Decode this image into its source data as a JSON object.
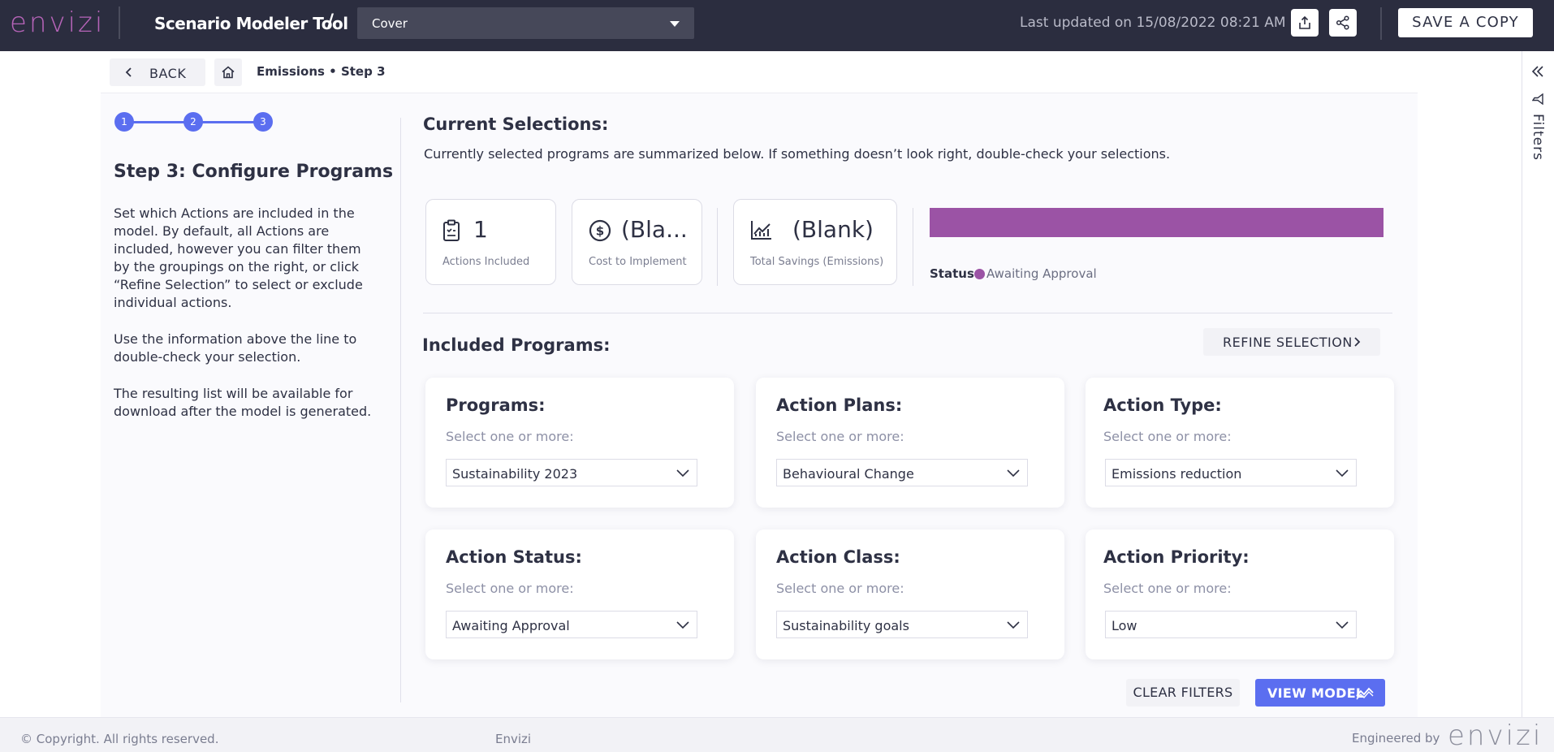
{
  "app": {
    "logo": "envizi",
    "title": "Scenario Modeler Tool",
    "slash": "/",
    "page_select": "Cover",
    "last_updated": "Last updated on 15/08/2022 08:21 AM",
    "save_copy": "SAVE A COPY"
  },
  "nav": {
    "back": "BACK",
    "breadcrumb": "Emissions • Step 3"
  },
  "stepper": {
    "steps": [
      "1",
      "2",
      "3"
    ],
    "current": 3
  },
  "left": {
    "title": "Step 3: Configure Programs",
    "para1": "Set which Actions are included in the model. By default, all Actions are included, however you can filter them by the groupings on the right, or click “Refine Selection” to select or exclude individual actions.",
    "para2": "Use the information above the line to double-check your selection.",
    "para3": "The resulting list will be available for download after the model is generated."
  },
  "current": {
    "heading": "Current Selections:",
    "subtext": "Currently selected programs are summarized below. If something doesn’t look right, double-check your selections.",
    "kpis": [
      {
        "value": "1",
        "label": "Actions Included",
        "icon": "clipboard-icon"
      },
      {
        "value": "(Bla...",
        "label": "Cost to Implement",
        "icon": "dollar-icon"
      },
      {
        "value": "(Blank)",
        "label": "Total Savings (Emissions)",
        "icon": "chart-icon"
      }
    ],
    "status_label": "Status",
    "status_value": "Awaiting Approval",
    "status_color": "#9b53a5"
  },
  "included": {
    "heading": "Included Programs:",
    "refine": "REFINE SELECTION",
    "hint": "Select one or more:",
    "filters": [
      {
        "title": "Programs:",
        "value": "Sustainability 2023"
      },
      {
        "title": "Action Plans:",
        "value": "Behavioural Change"
      },
      {
        "title": "Action Type:",
        "value": "Emissions reduction"
      },
      {
        "title": "Action Status:",
        "value": "Awaiting Approval"
      },
      {
        "title": "Action Class:",
        "value": "Sustainability goals"
      },
      {
        "title": "Action Priority:",
        "value": "Low"
      }
    ],
    "clear": "CLEAR FILTERS",
    "view": "VIEW MODEL"
  },
  "rail": {
    "label": "Filters"
  },
  "footer": {
    "copyright": "© Copyright. All rights reserved.",
    "center": "Envizi",
    "engineered": "Engineered by",
    "logo": "envizi"
  },
  "colors": {
    "accent": "#5b6ef0",
    "brand": "#b664b8",
    "topbar": "#2b2d3f"
  }
}
